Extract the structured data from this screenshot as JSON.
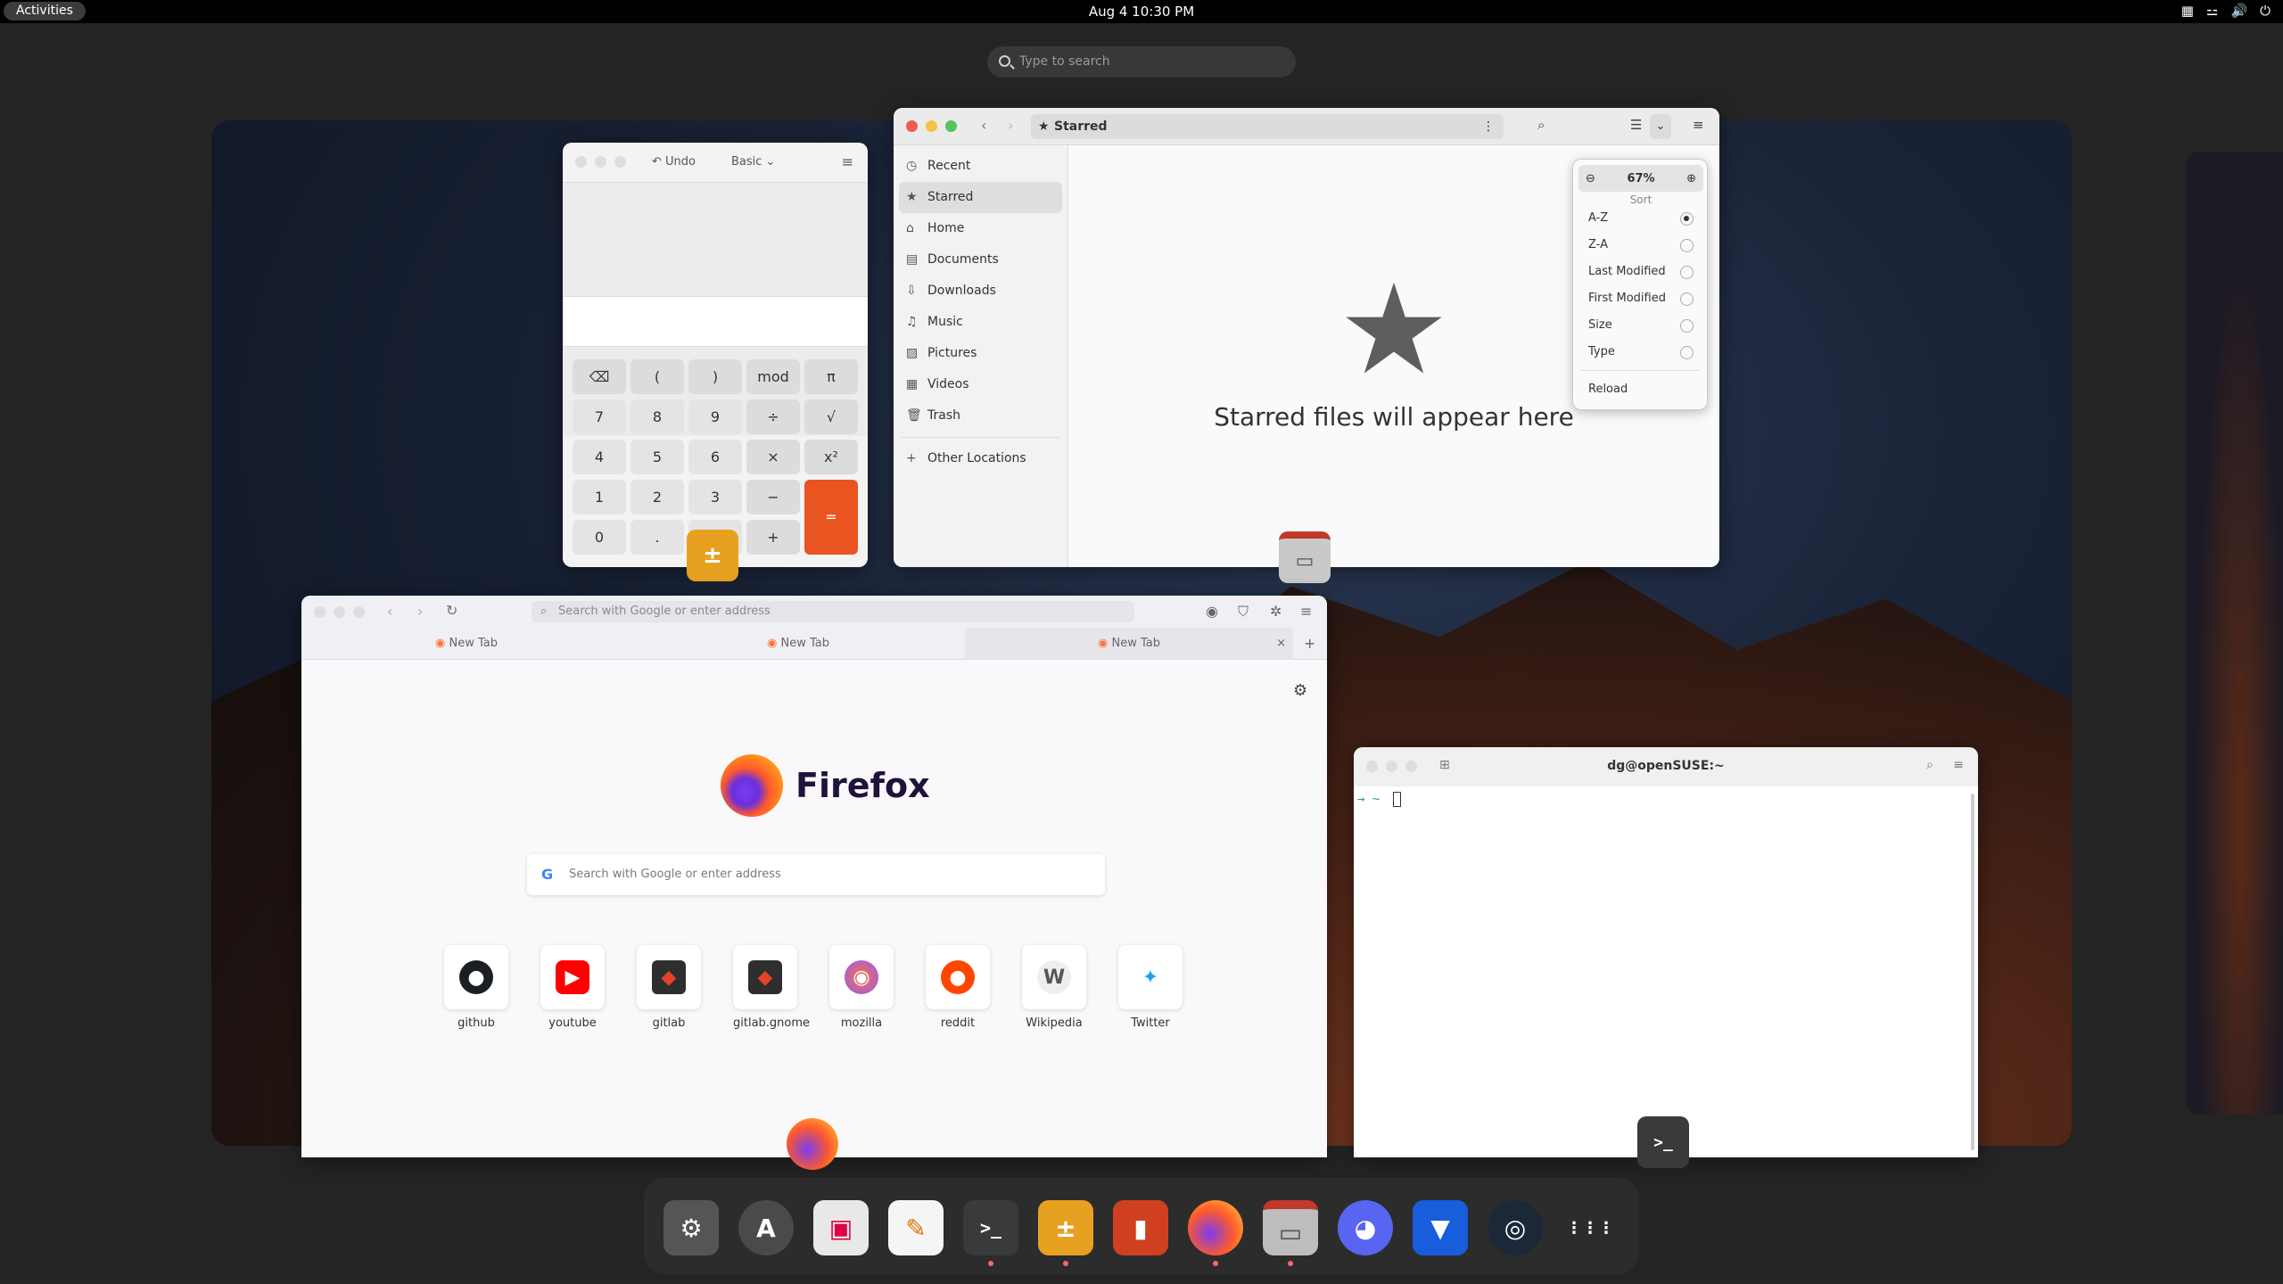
{
  "topbar": {
    "activities": "Activities",
    "clock": "Aug 4  10:30 PM",
    "tray": [
      "▦",
      "⚍",
      "🔊",
      "⏻"
    ]
  },
  "overview_search": {
    "placeholder": "Type to search"
  },
  "calculator": {
    "undo": "Undo",
    "mode": "Basic",
    "keys": [
      "⌫",
      "(",
      ")",
      "mod",
      "π",
      "7",
      "8",
      "9",
      "÷",
      "√",
      "4",
      "5",
      "6",
      "×",
      "x²",
      "1",
      "2",
      "3",
      "−",
      "=",
      "0",
      ".",
      "%",
      "+"
    ]
  },
  "files": {
    "location": "Starred",
    "sidebar": [
      {
        "icon": "clock-icon",
        "glyph": "◷",
        "label": "Recent"
      },
      {
        "icon": "star-icon",
        "glyph": "★",
        "label": "Starred"
      },
      {
        "icon": "home-icon",
        "glyph": "⌂",
        "label": "Home"
      },
      {
        "icon": "documents-icon",
        "glyph": "▤",
        "label": "Documents"
      },
      {
        "icon": "downloads-icon",
        "glyph": "⇩",
        "label": "Downloads"
      },
      {
        "icon": "music-icon",
        "glyph": "♫",
        "label": "Music"
      },
      {
        "icon": "pictures-icon",
        "glyph": "▨",
        "label": "Pictures"
      },
      {
        "icon": "videos-icon",
        "glyph": "▦",
        "label": "Videos"
      },
      {
        "icon": "trash-icon",
        "glyph": "🗑",
        "label": "Trash"
      }
    ],
    "other": {
      "glyph": "+",
      "label": "Other Locations"
    },
    "empty_text": "Starred files will appear here",
    "popover": {
      "zoom": "67%",
      "sort_title": "Sort",
      "options": [
        "A-Z",
        "Z-A",
        "Last Modified",
        "First Modified",
        "Size",
        "Type"
      ],
      "selected": "A-Z",
      "reload": "Reload"
    }
  },
  "firefox": {
    "address_placeholder": "Search with Google or enter address",
    "tabs": [
      "New Tab",
      "New Tab",
      "New Tab"
    ],
    "brand": "Firefox",
    "search_placeholder": "Search with Google or enter address",
    "shortcuts": [
      {
        "label": "github",
        "glyph": "●",
        "color": "#1b1f23"
      },
      {
        "label": "youtube",
        "glyph": "▶",
        "color": "#ff0000"
      },
      {
        "label": "gitlab",
        "glyph": "◆",
        "color": "#e24329"
      },
      {
        "label": "gitlab.gnome",
        "glyph": "◆",
        "color": "#e24329"
      },
      {
        "label": "mozilla",
        "glyph": "◉",
        "color": "#ff7139"
      },
      {
        "label": "reddit",
        "glyph": "●",
        "color": "#ff4500"
      },
      {
        "label": "Wikipedia",
        "glyph": "W",
        "color": "#777777"
      },
      {
        "label": "Twitter",
        "glyph": "✦",
        "color": "#1da1f2"
      }
    ]
  },
  "terminal": {
    "title": "dg@openSUSE:~",
    "prompt": "→  ~"
  },
  "dock": {
    "apps": [
      {
        "name": "settings",
        "glyph": "⚙",
        "bg": "#555"
      },
      {
        "name": "software",
        "glyph": "A",
        "bg": "#4a4a4a"
      },
      {
        "name": "store",
        "glyph": "▣",
        "bg": "#e8e8e8"
      },
      {
        "name": "text-editor",
        "glyph": "✎",
        "bg": "#f5f5f5"
      },
      {
        "name": "terminal",
        "glyph": ">_",
        "bg": "#3a3a3a"
      },
      {
        "name": "calculator",
        "glyph": "±",
        "bg": "#e8a020"
      },
      {
        "name": "bottles",
        "glyph": "▮",
        "bg": "#d04020"
      },
      {
        "name": "firefox",
        "glyph": "◉",
        "bg": "#ff7a1a"
      },
      {
        "name": "files",
        "glyph": "▭",
        "bg": "#bdbdbd"
      },
      {
        "name": "discord",
        "glyph": "◕",
        "bg": "#5865f2"
      },
      {
        "name": "bitwarden",
        "glyph": "▼",
        "bg": "#175ddc"
      },
      {
        "name": "steam",
        "glyph": "◎",
        "bg": "#1b2838"
      },
      {
        "name": "app-grid",
        "glyph": "⋮⋮⋮",
        "bg": "#2c2c2c"
      }
    ]
  }
}
